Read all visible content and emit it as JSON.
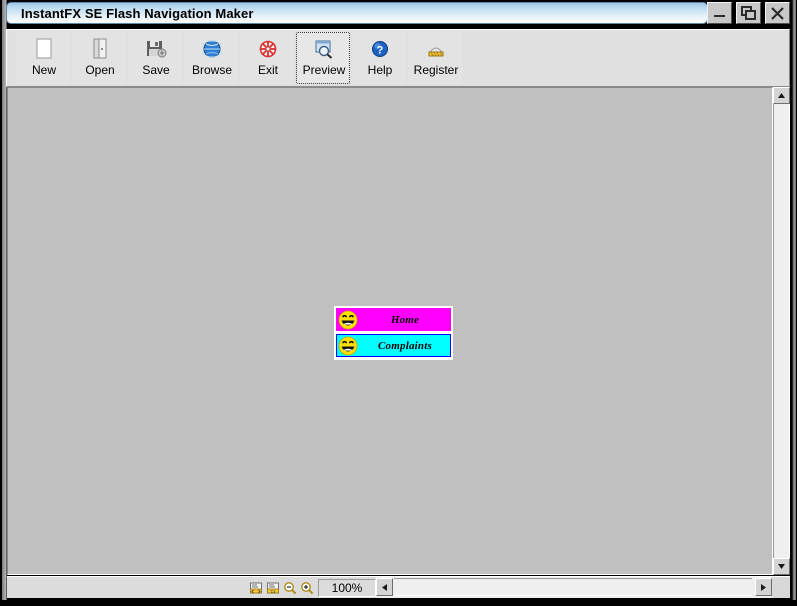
{
  "window": {
    "title": "InstantFX SE Flash Navigation Maker",
    "controls": [
      {
        "name": "minimize",
        "icon": "minimize-icon"
      },
      {
        "name": "restore",
        "icon": "restore-icon"
      },
      {
        "name": "close",
        "icon": "close-icon"
      }
    ]
  },
  "toolbar": {
    "buttons": [
      {
        "label": "New",
        "icon": "new-document-icon"
      },
      {
        "label": "Open",
        "icon": "open-folder-icon"
      },
      {
        "label": "Save",
        "icon": "floppy-disk-icon"
      },
      {
        "label": "Browse",
        "icon": "globe-icon"
      },
      {
        "label": "Exit",
        "icon": "exit-icon"
      },
      {
        "label": "Preview",
        "icon": "preview-magnifier-icon",
        "focused": true
      },
      {
        "label": "Help",
        "icon": "help-question-icon"
      },
      {
        "label": "Register",
        "icon": "register-icon"
      }
    ]
  },
  "canvas": {
    "nav_buttons": [
      {
        "label": "Home",
        "bg": "#ff00ff",
        "border": "#ff00ff",
        "icon": "smiley-face-icon"
      },
      {
        "label": "Complaints",
        "bg": "#00ffff",
        "border": "#0000ff",
        "icon": "smiley-face-icon"
      }
    ]
  },
  "statusbar": {
    "zoom_tools": [
      {
        "name": "fit-page-icon"
      },
      {
        "name": "actual-size-icon"
      },
      {
        "name": "zoom-out-icon"
      },
      {
        "name": "zoom-in-icon"
      }
    ],
    "zoom_value": "100%"
  },
  "colors": {
    "title_gradient_start": "#9fc7e8",
    "title_gradient_end": "#ffffff",
    "toolbar_bg": "#e0e0e0",
    "canvas_bg": "#c0c0c0",
    "accent_magenta": "#ff00ff",
    "accent_cyan": "#00ffff"
  }
}
